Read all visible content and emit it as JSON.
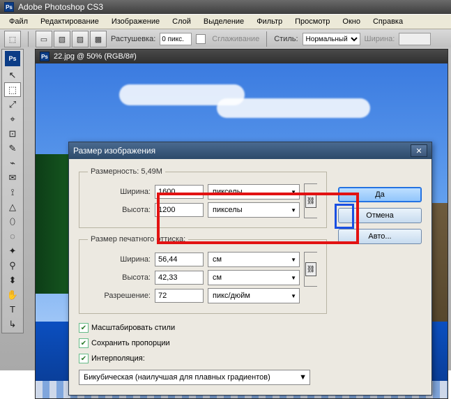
{
  "title": "Adobe Photoshop CS3",
  "menubar": [
    "Файл",
    "Редактирование",
    "Изображение",
    "Слой",
    "Выделение",
    "Фильтр",
    "Просмотр",
    "Окно",
    "Справка"
  ],
  "optbar": {
    "feather_label": "Растушевка:",
    "feather_value": "0 пикс.",
    "antialias_label": "Сглаживание",
    "style_label": "Стиль:",
    "style_value": "Нормальный",
    "width_label": "Ширина:"
  },
  "doc_title": "22.jpg @ 50% (RGB/8#)",
  "tools": [
    "↖",
    "⬚",
    "⤢",
    "⌖",
    "⊡",
    "✎",
    "⌁",
    "✉",
    "⟟",
    "△",
    "⬯",
    "◌",
    "✦",
    "⚲",
    "⬍",
    "✋",
    "T",
    "↳"
  ],
  "dialog": {
    "title": "Размер изображения",
    "dimension_label": "Размерность:",
    "dimension_value": "5,49M",
    "px": {
      "width_label": "Ширина:",
      "width_value": "1600",
      "height_label": "Высота:",
      "height_value": "1200",
      "unit": "пикселы"
    },
    "print_legend": "Размер печатного оттиска:",
    "print": {
      "width_label": "Ширина:",
      "width_value": "56,44",
      "height_label": "Высота:",
      "height_value": "42,33",
      "unit": "см",
      "res_label": "Разрешение:",
      "res_value": "72",
      "res_unit": "пикс/дюйм"
    },
    "cb_scale": "Масштабировать стили",
    "cb_constrain": "Сохранить пропорции",
    "cb_interp": "Интерполяция:",
    "interp_value": "Бикубическая (наилучшая для плавных градиентов)",
    "btn_ok": "Да",
    "btn_cancel": "Отмена",
    "btn_auto": "Авто..."
  }
}
